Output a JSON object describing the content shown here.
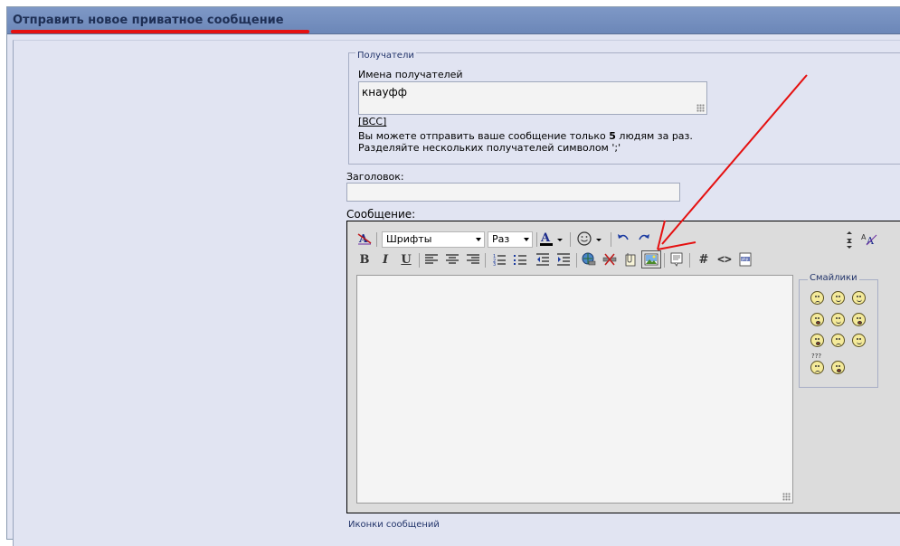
{
  "header": {
    "title": "Отправить новое приватное сообщение"
  },
  "recipients": {
    "legend": "Получатели",
    "names_label": "Имена получателей",
    "names_value": "кнауфф",
    "bcc_link": "[BCC]",
    "info_line1_pre": "Вы можете отправить ваше сообщение только ",
    "info_line1_count": "5",
    "info_line1_post": " людям за раз.",
    "info_line2": "Разделяйте нескольких получателей символом ';'"
  },
  "subject": {
    "label": "Заголовок:",
    "value": ""
  },
  "message": {
    "label": "Сообщение:",
    "value": ""
  },
  "toolbar": {
    "font_select": "Шрифты",
    "size_select": "Раз",
    "bold": "B",
    "italic": "I",
    "underline": "U",
    "hash": "#",
    "code": "<>"
  },
  "smilies": {
    "legend": "Смайлики",
    "items": [
      "frown",
      "rolleyes",
      "cool",
      "big-grin",
      "smile",
      "teeth",
      "eek",
      "confused",
      "wink",
      "question",
      "redface"
    ]
  },
  "bottom": {
    "legend": "Иконки сообщений"
  },
  "colors": {
    "titlebar": "#738fbf",
    "title_text": "#1e2f55",
    "page_bg": "#e1e4f2",
    "annotation_red": "#e51010"
  }
}
